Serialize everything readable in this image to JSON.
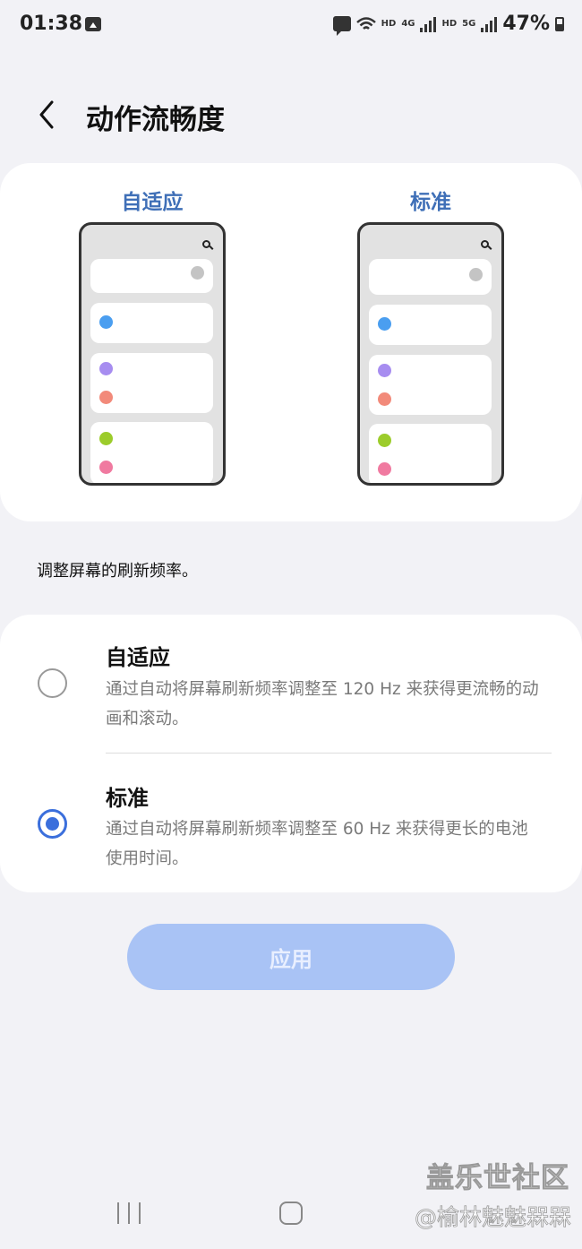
{
  "status_bar": {
    "time": "01:38",
    "hd1": "HD",
    "net1": "4G",
    "hd2": "HD",
    "net2": "5G",
    "battery": "47%"
  },
  "header": {
    "title": "动作流畅度"
  },
  "preview": {
    "adaptive_label": "自适应",
    "standard_label": "标准"
  },
  "description": "调整屏幕的刷新频率。",
  "options": [
    {
      "title": "自适应",
      "subtitle": "通过自动将屏幕刷新频率调整至 120 Hz 来获得更流畅的动画和滚动。",
      "selected": false
    },
    {
      "title": "标准",
      "subtitle": "通过自动将屏幕刷新频率调整至 60 Hz 来获得更长的电池使用时间。",
      "selected": true
    }
  ],
  "apply_label": "应用",
  "watermark": {
    "line1": "盖乐世社区",
    "line2": "@榆林魅魅槑槑"
  },
  "colors": {
    "accent": "#3b6fdc",
    "preview_label": "#3f6fb7",
    "apply_button": "#a9c3f5",
    "dot_blue": "#4a9ef0",
    "dot_purple": "#a78df0",
    "dot_salmon": "#f28a7a",
    "dot_green": "#9ccc2b",
    "dot_pink": "#f07aa0",
    "dot_gray": "#c4c4c4"
  }
}
